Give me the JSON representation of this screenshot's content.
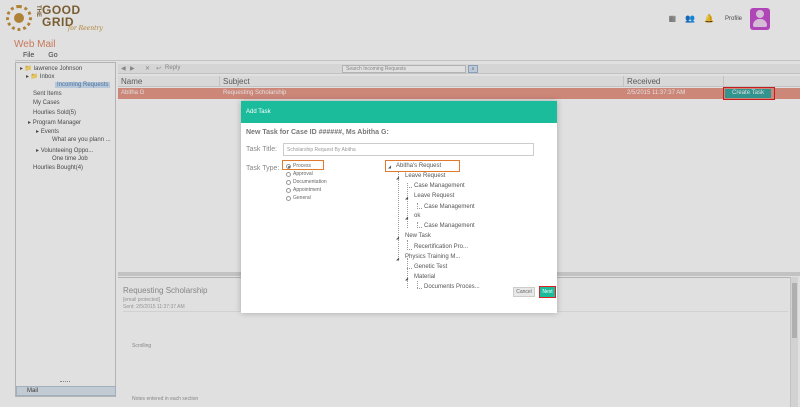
{
  "brand": {
    "the": "THE",
    "line1": "GOOD",
    "line2": "GRID",
    "tagline": "for Reentry"
  },
  "header": {
    "profile_label": "Profile"
  },
  "app": {
    "title": "Web Mail"
  },
  "menu": [
    "File",
    "Go"
  ],
  "sidebar": {
    "items": [
      {
        "label": "lawrence Johnson",
        "level": 0
      },
      {
        "label": "Inbox",
        "level": 1
      },
      {
        "label": "Incoming Requests",
        "level": 2,
        "selected": true
      },
      {
        "label": "Sent Items",
        "level": 1
      },
      {
        "label": "My Cases",
        "level": 1
      },
      {
        "label": "Hourlies Sold(5)",
        "level": 1
      },
      {
        "label": "Program Manager",
        "level": 1
      },
      {
        "label": "Events",
        "level": 2
      },
      {
        "label": "What are you plann ...",
        "level": 3
      },
      {
        "label": "Volunteeing Oppo...",
        "level": 2
      },
      {
        "label": "One time Job",
        "level": 3
      },
      {
        "label": "Hourlies Bought(4)",
        "level": 1
      }
    ],
    "footer_label": "Mail"
  },
  "toolbar": {
    "reply_label": "Reply",
    "search_placeholder": "Search Incoming Requests"
  },
  "list": {
    "columns": [
      "Name",
      "Subject",
      "Received"
    ],
    "rows": [
      {
        "name": "Abitha G",
        "subject": "Requesting Scholarship",
        "received": "2/5/2015 11:37:37 AM",
        "action": "Create Task"
      }
    ]
  },
  "preview": {
    "subject": "Requesting Scholarship",
    "email": "[email protected]",
    "sent": "Sent: 2/5/2015 11:37:37 AM",
    "body": "Scrolling",
    "notes": "Notes entered in each section"
  },
  "modal": {
    "title": "Add Task",
    "subtitle": "New Task for Case ID ######, Ms Abitha G:",
    "task_title_label": "Task Title:",
    "task_title_value": "Scholarship Request By Abitha",
    "task_type_label": "Task Type:",
    "task_types": [
      {
        "label": "Process",
        "checked": true
      },
      {
        "label": "Approval",
        "checked": false
      },
      {
        "label": "Documentation",
        "checked": false
      },
      {
        "label": "Appointment",
        "checked": false
      },
      {
        "label": "General",
        "checked": false
      }
    ],
    "tree": [
      {
        "label": "Abitha's Request",
        "level": 0,
        "expanded": true
      },
      {
        "label": "Leave Request",
        "level": 1,
        "expanded": true
      },
      {
        "label": "Case Management",
        "level": 2
      },
      {
        "label": "Leave Request",
        "level": 2,
        "expanded": true
      },
      {
        "label": "Case Management",
        "level": 3
      },
      {
        "label": "ok",
        "level": 2,
        "expanded": true
      },
      {
        "label": "Case Management",
        "level": 3
      },
      {
        "label": "New Task",
        "level": 1,
        "expanded": true
      },
      {
        "label": "Recertification Pro...",
        "level": 2
      },
      {
        "label": "Physics Training M...",
        "level": 1,
        "expanded": true
      },
      {
        "label": "Genetic Test",
        "level": 2
      },
      {
        "label": "Material",
        "level": 2,
        "expanded": true
      },
      {
        "label": "Documents Proces...",
        "level": 3
      }
    ],
    "cancel_label": "Cancel",
    "next_label": "Next"
  },
  "colors": {
    "accent": "#1abc9c",
    "row_highlight": "#e99a8a",
    "brand": "#8a6a3a",
    "annotation_red": "#e02020",
    "annotation_orange": "#e07a2e"
  }
}
